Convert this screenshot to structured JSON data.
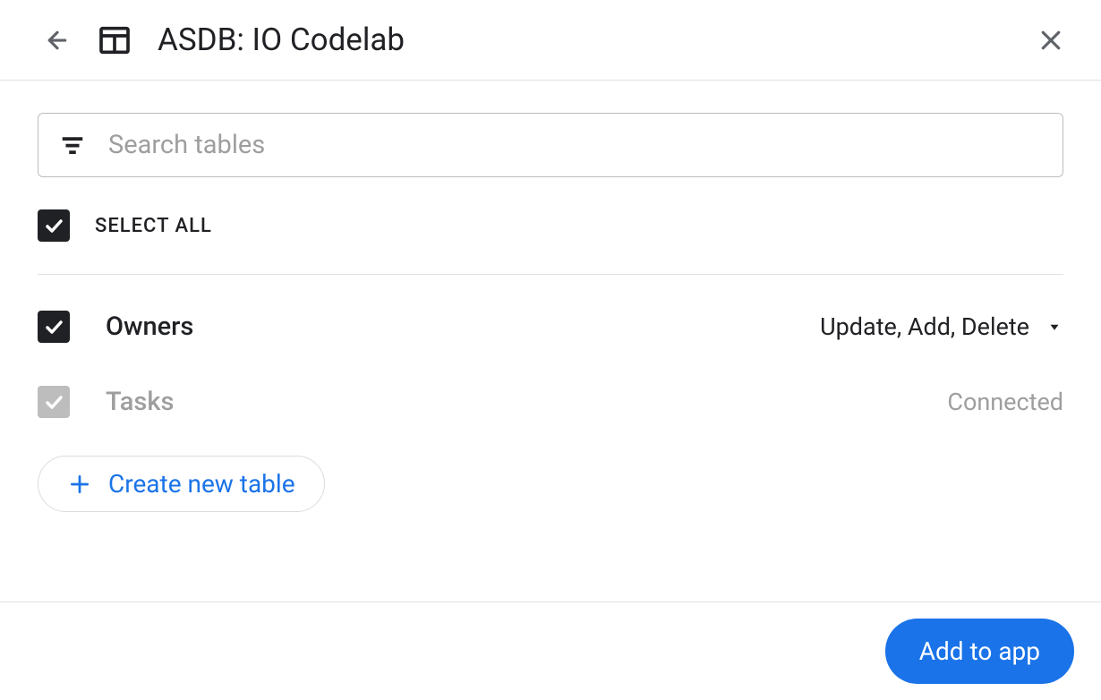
{
  "header": {
    "title": "ASDB: IO Codelab"
  },
  "search": {
    "placeholder": "Search tables"
  },
  "selectAll": {
    "label": "SELECT ALL"
  },
  "tables": [
    {
      "name": "Owners",
      "permissions": "Update, Add, Delete",
      "checked": true,
      "disabled": false
    },
    {
      "name": "Tasks",
      "status": "Connected",
      "checked": true,
      "disabled": true
    }
  ],
  "createTable": {
    "label": "Create new table"
  },
  "footer": {
    "addButton": "Add to app"
  }
}
